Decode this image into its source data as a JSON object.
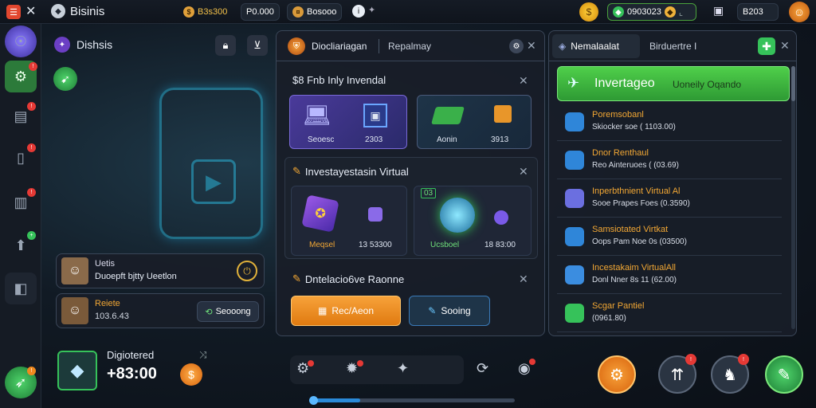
{
  "topbar": {
    "title": "Bisinis",
    "res1": "B3s300",
    "res2": "P0.000",
    "res3": "Bosooo",
    "right_value": "0903023",
    "right_value2": "B203"
  },
  "left_panel": {
    "title": "Dishsis",
    "user1_name": "Uetis",
    "user1_desc": "Duoepft bjtty Ueetlon",
    "user2_name": "Reiete",
    "user2_desc": "103.6.43",
    "user2_button": "Seooong",
    "bottom_title": "Digiotered",
    "bottom_value": "+83:00"
  },
  "center_panel": {
    "tab1": "Diocliariagan",
    "tab2": "Repalmay",
    "section1_title": "$8 Fnb Inly Invendal",
    "card1_label": "Seoesc",
    "card1_value": "2303",
    "card2_label": "Aonin",
    "card2_value": "3913",
    "section2_title": "Investayestasin Virtual",
    "card3_label": "Meqsel",
    "card3_value": "13 53300",
    "card4_tag": "03",
    "card4_label": "Ucsboel",
    "card4_value": "18 83:00",
    "section3_title": "Dntelacio6ve Raonne",
    "btn_primary": "Rec/Aeon",
    "btn_secondary": "Sooing"
  },
  "right_panel": {
    "tab1": "Nemalaalat",
    "tab2": "Birduertre I",
    "banner_title": "Invertageo",
    "banner_sub": "Uoneily Oqando",
    "items": [
      {
        "title": "Poremsobanl",
        "sub": "Skiocker soe ( 1103.00)",
        "color": "#2f86d9"
      },
      {
        "title": "Dnor Renthaul",
        "sub": "Reo Ainteruoes ( (03.69)",
        "color": "#2f86d9"
      },
      {
        "title": "Inperbthnient Virtual Al",
        "sub": "Sooe Prapes Foes (0.3590)",
        "color": "#6b6fe0"
      },
      {
        "title": "Samsiotated Virtkat",
        "sub": "Oops Pam Noe 0s (03500)",
        "color": "#2f86d9"
      },
      {
        "title": "Incestakaim VirtualAll",
        "sub": "Donl Nner 8s 11 (62.00)",
        "color": "#3b8de0"
      },
      {
        "title": "Scgar Pantiel",
        "sub": "(0961.80)",
        "color": "#36c25a"
      }
    ]
  },
  "colors": {
    "accent_green": "#3fbf45",
    "accent_orange": "#f0891e",
    "panel": "#181e28"
  }
}
